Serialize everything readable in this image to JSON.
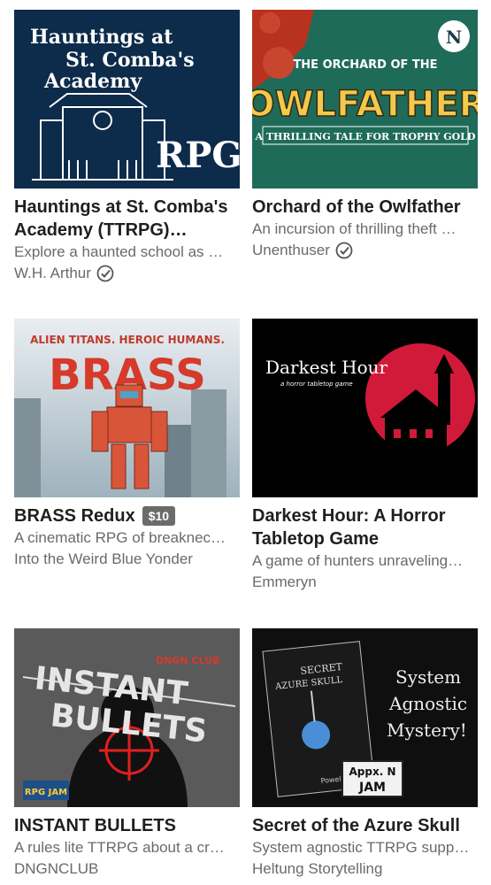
{
  "items": [
    {
      "title": "Hauntings at St. Comba's Academy (TTRPG)…",
      "description": "Explore a haunted school as …",
      "author": "W.H. Arthur",
      "verified": true,
      "price": "",
      "cover": {
        "line1": "Hauntings at",
        "line2": "St. Comba's",
        "line3": "Academy",
        "tag": "RPG",
        "bg": "#0d2b4a"
      }
    },
    {
      "title": "Orchard of the Owlfather",
      "description": "An incursion of thrilling theft …",
      "author": "Unenthuser",
      "verified": true,
      "price": "",
      "cover": {
        "top": "THE ORCHARD OF THE",
        "main": "OWLFATHER",
        "sub": "A THRILLING TALE FOR TROPHY GOLD",
        "badge": "N",
        "bg": "#1f6b5a"
      }
    },
    {
      "title": "BRASS Redux",
      "description": "A cinematic RPG of breaknec…",
      "author": "Into the Weird Blue Yonder",
      "verified": false,
      "price": "$10",
      "cover": {
        "top": "ALIEN TITANS. HEROIC HUMANS.",
        "main": "BRASS"
      }
    },
    {
      "title": "Darkest Hour: A Horror Tabletop Game",
      "description": "A game of hunters unraveling…",
      "author": "Emmeryn",
      "verified": false,
      "price": "",
      "cover": {
        "main": "Darkest Hour",
        "sub": "a horror tabletop game"
      }
    },
    {
      "title": "INSTANT BULLETS",
      "description": "A rules lite TTRPG about a cr…",
      "author": "DNGNCLUB",
      "verified": false,
      "price": "",
      "cover": {
        "line1": "INSTANT",
        "line2": "BULLETS",
        "club": "DNGN CLUB",
        "jam": "RPG JAM"
      }
    },
    {
      "title": "Secret of the Azure Skull",
      "description": "System agnostic TTRPG supp…",
      "author": "Heltung Storytelling",
      "verified": false,
      "price": "",
      "cover": {
        "book1": "SECRET",
        "book2": "AZURE SKULL",
        "side1": "System",
        "side2": "Agnostic",
        "side3": "Mystery!",
        "jam1": "Appx. N",
        "jam2": "JAM",
        "author": "Powel Kic"
      }
    }
  ]
}
